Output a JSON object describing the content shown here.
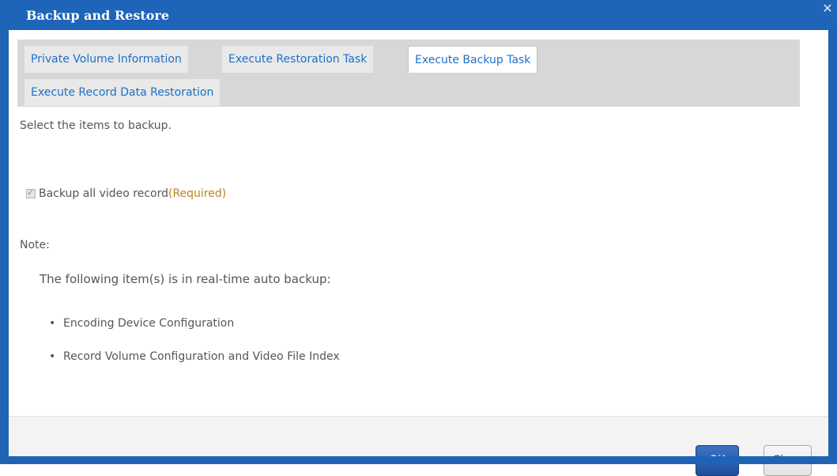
{
  "dialog": {
    "title": "Backup and Restore",
    "close_icon": "close-icon"
  },
  "tabs": [
    {
      "label": "Private Volume Information",
      "active": false
    },
    {
      "label": "Execute Restoration Task",
      "active": false
    },
    {
      "label": "Execute Backup Task",
      "active": true
    },
    {
      "label": "Execute Record Data Restoration",
      "active": false
    }
  ],
  "content": {
    "instruction": "Select the items to backup.",
    "checkbox_label": "Backup all video record",
    "checkbox_required": "(Required)",
    "checkbox_checked": true,
    "note_label": "Note:",
    "note_text": "The following item(s) is in real-time auto backup:",
    "bullets": [
      "Encoding Device Configuration",
      "Record Volume Configuration and Video File Index"
    ]
  },
  "footer": {
    "ok_label": "OK",
    "close_label": "Close"
  },
  "colors": {
    "title_bar": "#1e64b8",
    "tab_text": "#1f6fc6",
    "required": "#b8861a",
    "ok_button": "#2a5db0"
  }
}
